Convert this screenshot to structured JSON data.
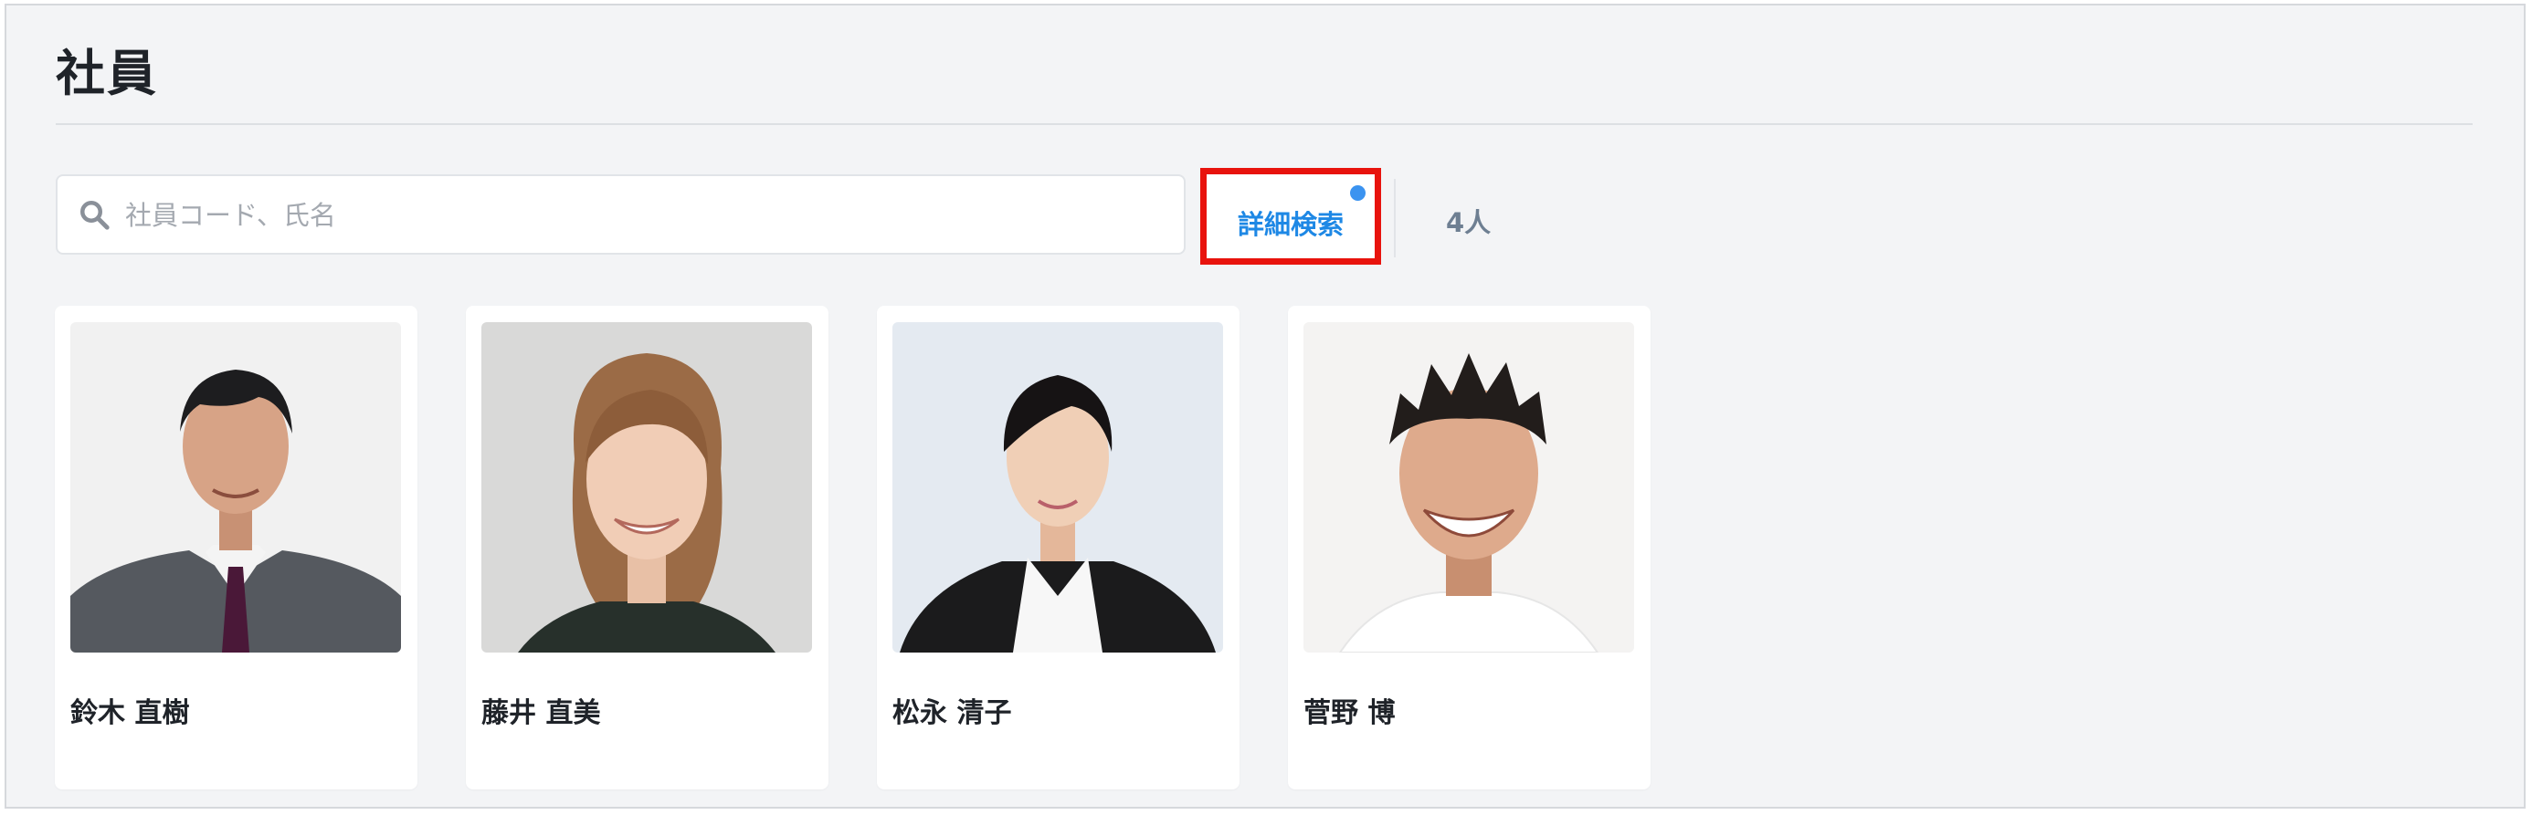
{
  "page": {
    "title": "社員"
  },
  "search": {
    "placeholder": "社員コード、氏名",
    "advanced_label": "詳細検索",
    "count_label": "4人"
  },
  "colors": {
    "accent": "#1e88e5",
    "highlight_border": "#e8130d",
    "filter_dot": "#3b93f0",
    "count_text": "#6e7f92"
  },
  "employees": [
    {
      "name": "鈴木 直樹",
      "photo": "man-gray-suit-portrait"
    },
    {
      "name": "藤井 直美",
      "photo": "woman-brown-hair-portrait"
    },
    {
      "name": "松永 清子",
      "photo": "woman-black-suit-portrait"
    },
    {
      "name": "菅野 博",
      "photo": "man-smiling-portrait"
    }
  ]
}
